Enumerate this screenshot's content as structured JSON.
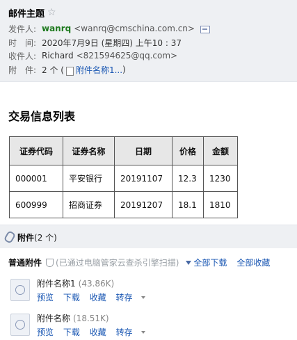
{
  "header": {
    "subject": "邮件主题",
    "star": "☆",
    "from_label": "发件人:",
    "from_name": "wanrq",
    "from_addr": "<wanrq@cmschina.com.cn>",
    "time_label": "时　间:",
    "time_value": "2020年7月9日 (星期四) 上午10 : 37",
    "to_label": "收件人:",
    "to_name": "Richard",
    "to_addr": "<821594625@qq.com>",
    "att_label": "附　件:",
    "att_count": "2 个 (",
    "att_first": "附件名称1...",
    "att_close": ")"
  },
  "body": {
    "title": "交易信息列表",
    "table": {
      "headers": [
        "证券代码",
        "证券名称",
        "日期",
        "价格",
        "金额"
      ],
      "rows": [
        [
          "000001",
          "平安银行",
          "20191107",
          "12.3",
          "1230"
        ],
        [
          "600999",
          "招商证券",
          "20191207",
          "18.1",
          "1810"
        ]
      ]
    }
  },
  "attachments": {
    "title": "附件",
    "count": "(2 个)",
    "normal_label": "普通附件",
    "scan_text": "(已通过电脑管家云查杀引擎扫描)",
    "download_all": "全部下载",
    "save_all": "全部收藏",
    "files": [
      {
        "name": "附件名称1",
        "size": "(43.86K)",
        "preview": "预览",
        "download": "下载",
        "save": "收藏",
        "forward": "转存"
      },
      {
        "name": "附件名称",
        "size": "(18.51K)",
        "preview": "预览",
        "download": "下载",
        "save": "收藏",
        "forward": "转存"
      }
    ]
  }
}
